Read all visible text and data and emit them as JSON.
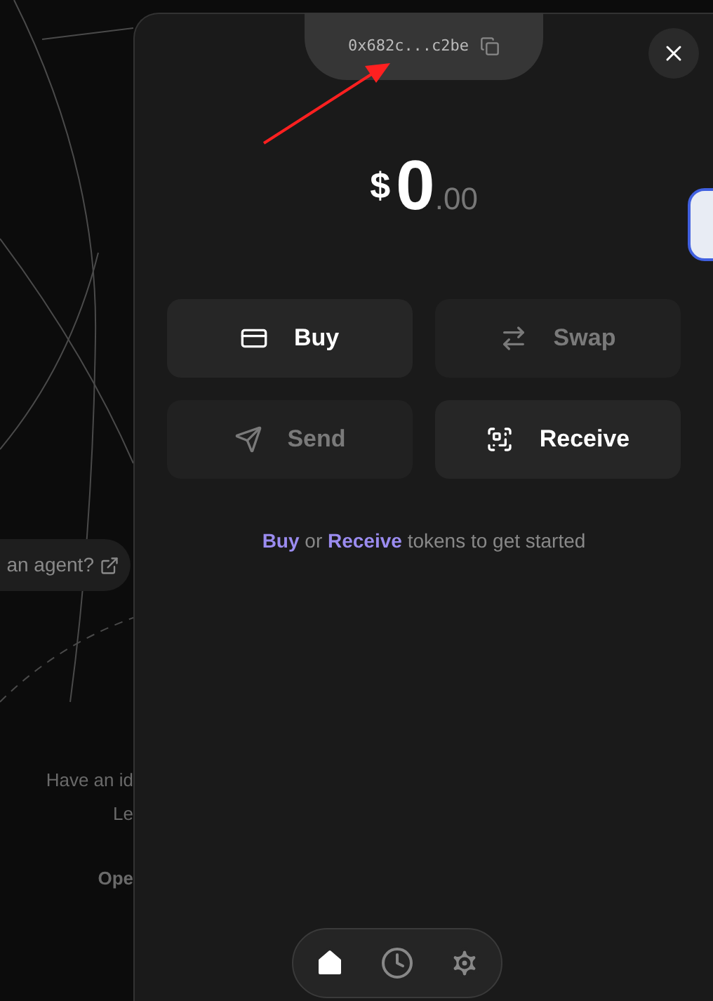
{
  "background": {
    "agent_link": "an agent?",
    "lines": [
      {
        "text": "Have an id",
        "kind": "plain"
      },
      {
        "text": "Le",
        "kind": "plain"
      },
      {
        "text": "Ope",
        "kind": "strong"
      }
    ]
  },
  "wallet": {
    "address": "0x682c...c2be",
    "balance": {
      "currency": "$",
      "whole": "0",
      "fraction": ".00"
    },
    "actions": [
      {
        "kind": "buy",
        "label": "Buy",
        "disabled": false
      },
      {
        "kind": "swap",
        "label": "Swap",
        "disabled": true
      },
      {
        "kind": "send",
        "label": "Send",
        "disabled": true
      },
      {
        "kind": "receive",
        "label": "Receive",
        "disabled": false
      }
    ],
    "hint": "**Buy** or **Receive** tokens to get started",
    "nav": [
      {
        "kind": "home",
        "selected": true
      },
      {
        "kind": "history",
        "selected": false
      },
      {
        "kind": "settings",
        "selected": false
      }
    ]
  }
}
